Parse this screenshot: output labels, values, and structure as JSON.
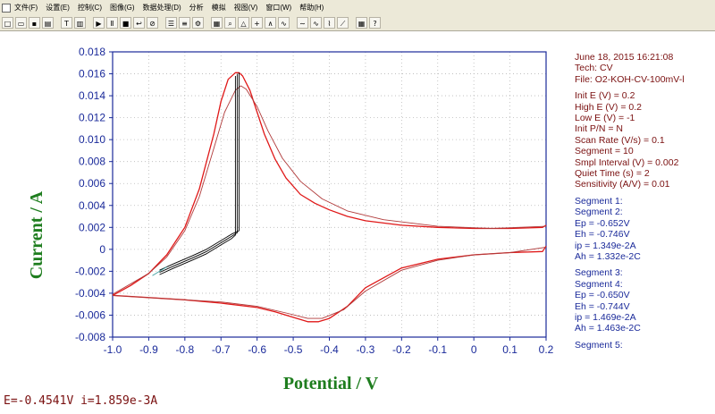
{
  "menu": [
    "文件(F)",
    "设置(E)",
    "控制(C)",
    "图像(G)",
    "数据处理(D)",
    "分析",
    "模拟",
    "视图(V)",
    "窗口(W)",
    "帮助(H)"
  ],
  "toolbar": {
    "groups": [
      [
        "new-icon",
        "open-icon",
        "save-icon",
        "print-icon"
      ],
      [
        "text-icon",
        "page-icon"
      ],
      [
        "run-icon",
        "pause-icon",
        "stop-icon",
        "reverse-icon",
        "clear-icon"
      ],
      [
        "parameters-icon",
        "technique-icon",
        "settings-icon"
      ],
      [
        "graph-icon",
        "zoom-icon",
        "overlay-icon",
        "add-icon",
        "peak-icon",
        "smooth-icon"
      ],
      [
        "wave1-icon",
        "wave2-icon",
        "wave3-icon",
        "wave4-icon"
      ],
      [
        "calculator-icon",
        "help-icon"
      ]
    ],
    "glyphs": {
      "new-icon": "□",
      "open-icon": "▭",
      "save-icon": "▪",
      "print-icon": "▤",
      "text-icon": "T",
      "page-icon": "▥",
      "run-icon": "▶",
      "pause-icon": "Ⅱ",
      "stop-icon": "■",
      "reverse-icon": "↩",
      "clear-icon": "⊘",
      "parameters-icon": "☰",
      "technique-icon": "≡",
      "settings-icon": "⚙",
      "graph-icon": "▦",
      "zoom-icon": "⌕",
      "overlay-icon": "△",
      "add-icon": "+",
      "peak-icon": "∧",
      "smooth-icon": "∿",
      "wave1-icon": "∼",
      "wave2-icon": "∿",
      "wave3-icon": "⌇",
      "wave4-icon": "⟋",
      "calculator-icon": "▦",
      "help-icon": "?"
    }
  },
  "chart_data": {
    "type": "line",
    "xlabel": "Potential / V",
    "ylabel": "Current / A",
    "xlim": [
      -1.0,
      0.2
    ],
    "ylim": [
      -0.008,
      0.018
    ],
    "x_ticks": [
      "-1.0",
      "-0.9",
      "-0.8",
      "-0.7",
      "-0.6",
      "-0.5",
      "-0.4",
      "-0.3",
      "-0.2",
      "-0.1",
      "0",
      "0.1",
      "0.2"
    ],
    "y_ticks": [
      "-0.008",
      "-0.006",
      "-0.004",
      "-0.002",
      "0",
      "0.002",
      "0.004",
      "0.006",
      "0.008",
      "0.010",
      "0.012",
      "0.014",
      "0.016",
      "0.018"
    ],
    "grid": true,
    "series": [
      {
        "color": "#e01818",
        "x": [
          -1.0,
          -0.95,
          -0.9,
          -0.85,
          -0.8,
          -0.76,
          -0.72,
          -0.7,
          -0.68,
          -0.66,
          -0.65,
          -0.64,
          -0.62,
          -0.6,
          -0.58,
          -0.55,
          -0.52,
          -0.48,
          -0.44,
          -0.4,
          -0.35,
          -0.3,
          -0.2,
          -0.1,
          0.0,
          0.1,
          0.19,
          0.2
        ],
        "y": [
          -0.0042,
          -0.0033,
          -0.0022,
          -0.0005,
          0.002,
          0.0055,
          0.0105,
          0.0135,
          0.0155,
          0.0161,
          0.0161,
          0.0158,
          0.0145,
          0.0125,
          0.0105,
          0.0082,
          0.0065,
          0.005,
          0.0042,
          0.0036,
          0.003,
          0.0026,
          0.0022,
          0.002,
          0.0019,
          0.0019,
          0.002,
          0.0022
        ]
      },
      {
        "color": "#e01818",
        "x": [
          0.2,
          0.19,
          0.1,
          0.0,
          -0.1,
          -0.2,
          -0.3,
          -0.35,
          -0.4,
          -0.43,
          -0.46,
          -0.5,
          -0.55,
          -0.6,
          -0.7,
          -0.8,
          -0.9,
          -1.0
        ],
        "y": [
          0.0003,
          -0.0002,
          -0.0003,
          -0.0005,
          -0.0009,
          -0.0017,
          -0.0035,
          -0.0052,
          -0.0063,
          -0.0066,
          -0.0066,
          -0.0062,
          -0.0057,
          -0.0053,
          -0.0049,
          -0.0046,
          -0.0044,
          -0.0042
        ]
      },
      {
        "color": "#b03a3a",
        "x": [
          -1.0,
          -0.9,
          -0.85,
          -0.8,
          -0.76,
          -0.72,
          -0.69,
          -0.66,
          -0.645,
          -0.63,
          -0.6,
          -0.57,
          -0.53,
          -0.48,
          -0.42,
          -0.35,
          -0.25,
          -0.1,
          0.05,
          0.2
        ],
        "y": [
          -0.0041,
          -0.0022,
          -0.0007,
          0.0017,
          0.0048,
          0.0092,
          0.0125,
          0.0145,
          0.0149,
          0.0146,
          0.013,
          0.0108,
          0.0083,
          0.0062,
          0.0046,
          0.0035,
          0.0027,
          0.0021,
          0.0019,
          0.0021
        ]
      },
      {
        "color": "#b03a3a",
        "x": [
          0.2,
          0.1,
          0.0,
          -0.1,
          -0.2,
          -0.3,
          -0.36,
          -0.42,
          -0.46,
          -0.52,
          -0.6,
          -0.7,
          -0.85,
          -1.0
        ],
        "y": [
          0.0002,
          -0.0003,
          -0.0005,
          -0.001,
          -0.0019,
          -0.0038,
          -0.0055,
          -0.0063,
          -0.0063,
          -0.0058,
          -0.0052,
          -0.0048,
          -0.0045,
          -0.0042
        ]
      },
      {
        "color": "#000000",
        "x": [
          -0.87,
          -0.83,
          -0.78,
          -0.74,
          -0.7,
          -0.67,
          -0.65,
          -0.65,
          -0.65
        ],
        "y": [
          -0.0019,
          -0.0013,
          -0.0006,
          0.0,
          0.0008,
          0.0014,
          0.0017,
          0.0085,
          0.0161
        ]
      },
      {
        "color": "#000000",
        "x": [
          -0.87,
          -0.83,
          -0.78,
          -0.74,
          -0.7,
          -0.67,
          -0.655,
          -0.655
        ],
        "y": [
          -0.0021,
          -0.0015,
          -0.0008,
          -0.0002,
          0.0006,
          0.0012,
          0.0015,
          0.016
        ]
      },
      {
        "color": "#000000",
        "x": [
          -0.87,
          -0.83,
          -0.78,
          -0.74,
          -0.7,
          -0.67,
          -0.66,
          -0.66
        ],
        "y": [
          -0.0023,
          -0.0017,
          -0.001,
          -0.0004,
          0.0004,
          0.001,
          0.0013,
          0.0158
        ]
      },
      {
        "color": "#3fa0a0",
        "x": [
          -0.89,
          -0.87,
          -0.85
        ],
        "y": [
          -0.0024,
          -0.002,
          -0.0016
        ]
      }
    ]
  },
  "info": {
    "date": "June 18, 2015    16:21:08",
    "tech": "Tech: CV",
    "file": "File: O2-KOH-CV-100mV-l",
    "params": [
      "Init E (V) = 0.2",
      "High E (V) = 0.2",
      "Low E (V) = -1",
      "Init P/N = N",
      "Scan Rate (V/s) = 0.1",
      "Segment = 10",
      "Smpl Interval (V) = 0.002",
      "Quiet Time (s) = 2",
      "Sensitivity (A/V) = 0.01"
    ],
    "segments1": [
      "Segment 1:",
      "Segment 2:",
      "Ep = -0.652V",
      "Eh = -0.746V",
      "ip = 1.349e-2A",
      "Ah = 1.332e-2C"
    ],
    "segments2": [
      "Segment 3:",
      "Segment 4:",
      "Ep = -0.650V",
      "Eh = -0.744V",
      "ip = 1.469e-2A",
      "Ah = 1.463e-2C"
    ],
    "segments3": [
      "Segment 5:"
    ]
  },
  "status": "E=-0.4541V  i=1.859e-3A"
}
